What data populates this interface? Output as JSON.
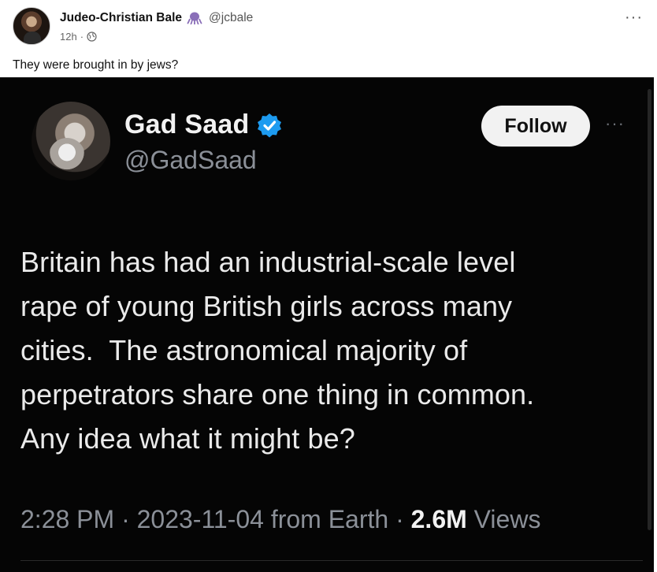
{
  "post": {
    "author_name": "Judeo-Christian Bale",
    "author_handle": "@jcbale",
    "timestamp": "12h",
    "separator": "·",
    "text": "They were brought in by jews?",
    "more_label": "···"
  },
  "embedded_tweet": {
    "name": "Gad Saad",
    "handle": "@GadSaad",
    "follow_label": "Follow",
    "more_label": "···",
    "body_lines": [
      "Britain has had an industrial-scale level",
      "rape of young British girls across many",
      "cities.  The astronomical majority of",
      "perpetrators share one thing in common.",
      "Any idea what it might be?"
    ],
    "meta_prefix": "2:28 PM · 2023-11-04 from Earth · ",
    "views_count": "2.6M",
    "views_label": " Views"
  },
  "icons": {
    "octopus": "octopus-icon",
    "globe": "globe-icon",
    "verified": "verified-badge-icon"
  },
  "colors": {
    "verified_blue": "#1d9bf0",
    "octopus_purple": "#8a6fb8",
    "tweet_background": "#050505"
  }
}
